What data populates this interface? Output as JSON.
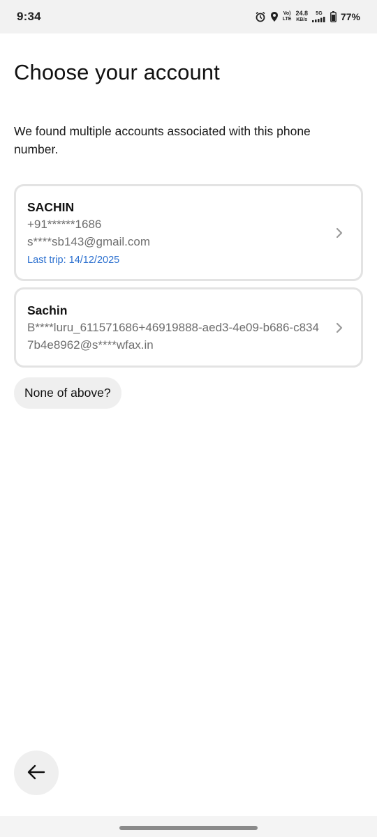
{
  "status_bar": {
    "time": "9:34",
    "volte_top": "Vo)",
    "volte_bottom": "LTE",
    "net_speed_value": "24.8",
    "net_speed_unit": "KB/s",
    "network_type": "5G",
    "battery_percent": "77%"
  },
  "page": {
    "title": "Choose your account",
    "subtitle": "We found multiple accounts associated with this phone number."
  },
  "accounts": [
    {
      "name": "SACHIN",
      "phone": "+91******1686",
      "email": "s****sb143@gmail.com",
      "last_trip": "Last trip: 14/12/2025"
    },
    {
      "name": "Sachin",
      "email": "B****luru_611571686+46919888-aed3-4e09-b686-c8347b4e8962@s****wfax.in"
    }
  ],
  "none_button_label": "None of above?",
  "icons": {
    "back": "arrow-left-icon",
    "chevron": "chevron-right-icon",
    "alarm": "alarm-icon",
    "location": "location-icon",
    "signal": "signal-icon",
    "battery": "battery-icon"
  },
  "colors": {
    "trip_text": "#2a6fcf",
    "card_border": "#e3e3e3",
    "button_bg": "#efefef"
  }
}
